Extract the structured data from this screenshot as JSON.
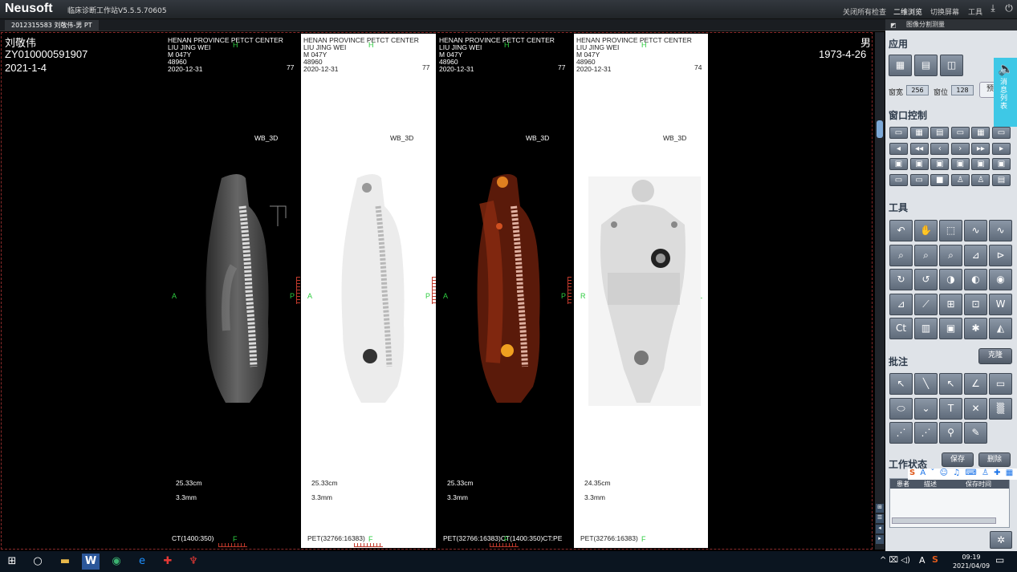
{
  "app": {
    "brand": "Neusoft",
    "title": "临床诊断工作站V5.5.5.70605"
  },
  "menu": {
    "close_all": "关闭所有检查",
    "view_2d": "二维浏览",
    "switch_screen": "切换屏幕",
    "tools": "工具"
  },
  "tab": {
    "label": "2012315583 刘敬伟-男 PT"
  },
  "patient": {
    "name": "刘敬伟",
    "id": "ZY010000591907",
    "study_date": "2021-1-4",
    "sex": "男",
    "birth_date": "1973-4-26"
  },
  "viewports": [
    {
      "l1": "HENAN PROVINCE PETCT CENTER",
      "l2": "LIU JING WEI",
      "l3": "M  047Y",
      "l4": "48960",
      "l5": "2020-12-31",
      "slice": "77",
      "series": "WB_3D",
      "left": "A",
      "right": "P",
      "top": "H",
      "bottom": "F",
      "dist": "25.33cm",
      "thick": "3.3mm",
      "window": "CT(1400:350)"
    },
    {
      "l1": "HENAN PROVINCE PETCT CENTER",
      "l2": "LIU JING WEI",
      "l3": "M  047Y",
      "l4": "48960",
      "l5": "2020-12-31",
      "slice": "77",
      "series": "WB_3D",
      "left": "A",
      "right": "P",
      "top": "H",
      "bottom": "F",
      "dist": "25.33cm",
      "thick": "3.3mm",
      "window": "PET(32766:16383)"
    },
    {
      "l1": "HENAN PROVINCE PETCT CENTER",
      "l2": "LIU JING WEI",
      "l3": "M  047Y",
      "l4": "48960",
      "l5": "2020-12-31",
      "slice": "77",
      "series": "WB_3D",
      "left": "A",
      "right": "P",
      "top": "H",
      "bottom": "F",
      "dist": "25.33cm",
      "thick": "3.3mm",
      "window": "PET(32766:16383)CT(1400:350)CT:PE"
    },
    {
      "l1": "HENAN PROVINCE PETCT CENTER",
      "l2": "LIU JING WEI",
      "l3": "M  047Y",
      "l4": "48960",
      "l5": "2020-12-31",
      "slice": "74",
      "series": "WB_3D",
      "left": "R",
      "right": "L",
      "top": "H",
      "bottom": "F",
      "dist": "24.35cm",
      "thick": "3.3mm",
      "window": "PET(32766:16383)"
    }
  ],
  "panel": {
    "header": "图像分割测量",
    "sec_app": "应用",
    "ww_label": "窗宽",
    "ww_value": "256",
    "wl_label": "窗位",
    "wl_value": "128",
    "preset_label": "预",
    "sec_window": "窗口控制",
    "sec_tools": "工具",
    "clone_label": "克隆",
    "sec_annot": "批注",
    "sec_status": "工作状态",
    "save_label": "保存",
    "delete_label": "删除",
    "grid_cols": [
      "患者",
      "描述",
      "保存时间"
    ]
  },
  "msgtab": {
    "label": "消息列表"
  },
  "taskbar": {
    "time": "09:19",
    "date": "2021/04/09",
    "ime": "A"
  }
}
